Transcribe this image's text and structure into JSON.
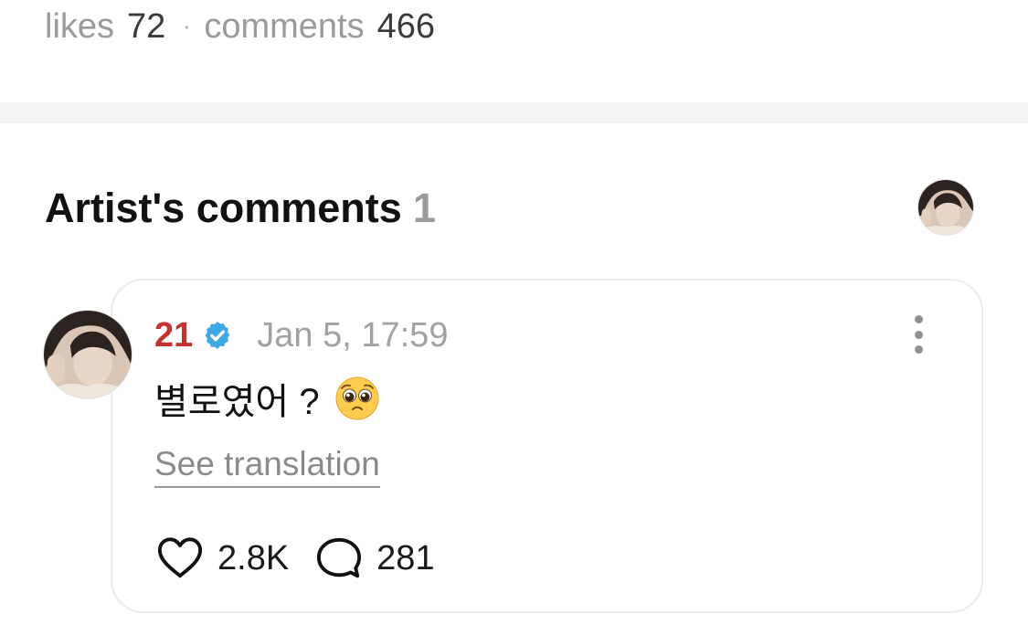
{
  "post_stats": {
    "likes_label": "likes",
    "likes_count": "72",
    "separator": "·",
    "comments_label": "comments",
    "comments_count": "466"
  },
  "artist_comments": {
    "title": "Artist's comments",
    "count": "1"
  },
  "comment": {
    "author": "21",
    "timestamp": "Jan 5, 17:59",
    "text": "별로였어 ?",
    "emoji_icon": "pleading-face-icon",
    "see_translation": "See translation",
    "likes": "2.8K",
    "replies": "281"
  },
  "colors": {
    "author": "#c8302c",
    "verified": "#3fa9e6",
    "muted": "#9a9a9a",
    "divider": "#f3f3f3"
  }
}
